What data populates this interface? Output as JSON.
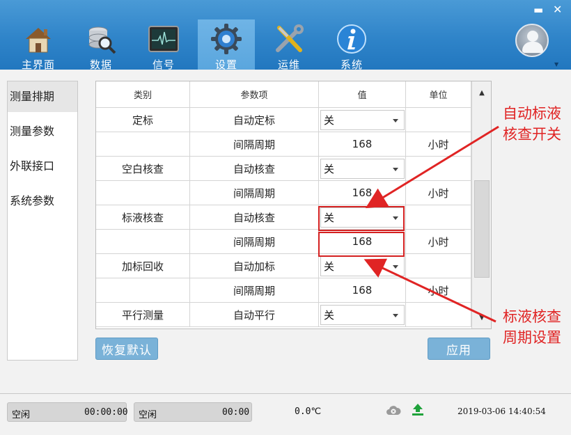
{
  "window": {
    "minimize_glyph": "▬",
    "close_glyph": "✕"
  },
  "nav": {
    "items": [
      {
        "label": "主界面",
        "icon": "home-icon"
      },
      {
        "label": "数据",
        "icon": "database-search-icon"
      },
      {
        "label": "信号",
        "icon": "signal-monitor-icon"
      },
      {
        "label": "设置",
        "icon": "gear-icon"
      },
      {
        "label": "运维",
        "icon": "tools-icon"
      },
      {
        "label": "系统",
        "icon": "info-icon"
      }
    ],
    "active": "设置"
  },
  "sidebar": {
    "items": [
      {
        "label": "测量排期"
      },
      {
        "label": "测量参数"
      },
      {
        "label": "外联接口"
      },
      {
        "label": "系统参数"
      }
    ]
  },
  "table": {
    "headers": [
      "类别",
      "参数项",
      "值",
      "单位"
    ],
    "rows": [
      {
        "category": "定标",
        "param": "自动定标",
        "value": "关",
        "unit": ""
      },
      {
        "category": "",
        "param": "间隔周期",
        "value": "168",
        "unit": "小时"
      },
      {
        "category": "空白核查",
        "param": "自动核查",
        "value": "关",
        "unit": ""
      },
      {
        "category": "",
        "param": "间隔周期",
        "value": "168",
        "unit": "小时"
      },
      {
        "category": "标液核查",
        "param": "自动核查",
        "value": "关",
        "unit": ""
      },
      {
        "category": "",
        "param": "间隔周期",
        "value": "168",
        "unit": "小时"
      },
      {
        "category": "加标回收",
        "param": "自动加标",
        "value": "关",
        "unit": ""
      },
      {
        "category": "",
        "param": "间隔周期",
        "value": "168",
        "unit": "小时"
      },
      {
        "category": "平行测量",
        "param": "自动平行",
        "value": "关",
        "unit": ""
      }
    ]
  },
  "buttons": {
    "reset": "恢复默认",
    "apply": "应用"
  },
  "annotations": {
    "top_line1": "自动标液",
    "top_line2": "核查开关",
    "bottom_line1": "标液核查",
    "bottom_line2": "周期设置",
    "color": "#e02424"
  },
  "status": {
    "box1_state": "空闲",
    "box1_time": "00:00:00",
    "box2_state": "空闲",
    "box2_time": "00:00",
    "temperature": "0.0℃",
    "datetime": "2019-03-06 14:40:54"
  },
  "colors": {
    "toolbar": "#2f84c9",
    "button": "#7ab2d8",
    "highlight": "#d42020"
  }
}
